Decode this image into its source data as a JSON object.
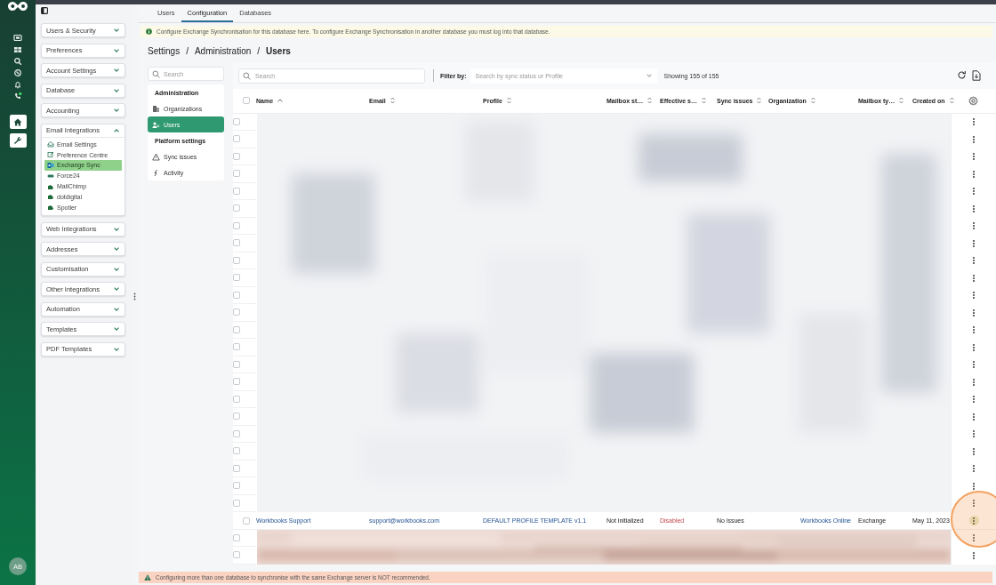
{
  "rail": {
    "avatar": "AB"
  },
  "side_menu": {
    "sections": [
      {
        "label": "Users & Security",
        "expanded": false
      },
      {
        "label": "Preferences",
        "expanded": false
      },
      {
        "label": "Account Settings",
        "expanded": false
      },
      {
        "label": "Database",
        "expanded": false
      },
      {
        "label": "Accounting",
        "expanded": false
      },
      {
        "label": "Email Integrations",
        "expanded": true,
        "items": [
          {
            "label": "Email Settings",
            "selected": false
          },
          {
            "label": "Preference Centre",
            "selected": false
          },
          {
            "label": "Exchange Sync",
            "selected": true
          },
          {
            "label": "Force24",
            "selected": false
          },
          {
            "label": "MailChimp",
            "selected": false
          },
          {
            "label": "dotdigital",
            "selected": false
          },
          {
            "label": "Spotler",
            "selected": false
          }
        ]
      },
      {
        "label": "Web Integrations",
        "expanded": false
      },
      {
        "label": "Addresses",
        "expanded": false
      },
      {
        "label": "Customisation",
        "expanded": false
      },
      {
        "label": "Other Integrations",
        "expanded": false
      },
      {
        "label": "Automation",
        "expanded": false
      },
      {
        "label": "Templates",
        "expanded": false
      },
      {
        "label": "PDF Templates",
        "expanded": false
      }
    ]
  },
  "tabs": [
    {
      "label": "Users",
      "selected": false
    },
    {
      "label": "Configuration",
      "selected": true
    },
    {
      "label": "Databases",
      "selected": false
    }
  ],
  "info_banner": "Configure Exchange Synchronisation for this database here. To configure Exchange Synchronisation in another database you must log into that database.",
  "breadcrumb": {
    "separator": "/",
    "items": [
      "Settings",
      "Administration",
      "Users"
    ]
  },
  "settings_nav": {
    "search_placeholder": "Search",
    "groups": [
      {
        "heading": "Administration",
        "items": [
          {
            "label": "Organizations",
            "selected": false
          },
          {
            "label": "Users",
            "selected": true
          }
        ]
      },
      {
        "heading": "Platform settings",
        "items": [
          {
            "label": "Sync issues",
            "selected": false
          },
          {
            "label": "Activity",
            "selected": false
          }
        ]
      }
    ]
  },
  "toolbar": {
    "search_placeholder": "Search",
    "filter_label": "Filter by:",
    "filter_placeholder": "Search by sync status or Profile",
    "count": "Showing 155 of 155"
  },
  "table": {
    "select_all": {
      "checked": false
    },
    "columns": [
      {
        "label": "Name",
        "sorted": true
      },
      {
        "label": "Email",
        "sorted": false
      },
      {
        "label": "Profile",
        "sorted": false
      },
      {
        "label": "Mailbox st…",
        "sorted": false
      },
      {
        "label": "Effective s…",
        "sorted": false
      },
      {
        "label": "Sync issues",
        "sorted": false
      },
      {
        "label": "Organization",
        "sorted": false
      },
      {
        "label": "Mailbox ty…",
        "sorted": false
      },
      {
        "label": "Created on",
        "sorted": false
      }
    ],
    "rows": [
      {
        "kind": "blurred",
        "checked": false,
        "highlighted": false
      },
      {
        "kind": "blurred",
        "checked": false,
        "highlighted": false
      },
      {
        "kind": "blurred",
        "checked": false,
        "highlighted": false
      },
      {
        "kind": "blurred",
        "checked": false,
        "highlighted": false
      },
      {
        "kind": "blurred",
        "checked": false,
        "highlighted": false
      },
      {
        "kind": "blurred",
        "checked": false,
        "highlighted": false
      },
      {
        "kind": "blurred",
        "checked": false,
        "highlighted": false
      },
      {
        "kind": "blurred",
        "checked": false,
        "highlighted": false
      },
      {
        "kind": "blurred",
        "checked": false,
        "highlighted": false
      },
      {
        "kind": "blurred",
        "checked": false,
        "highlighted": false
      },
      {
        "kind": "blurred",
        "checked": false,
        "highlighted": false
      },
      {
        "kind": "blurred",
        "checked": false,
        "highlighted": false
      },
      {
        "kind": "blurred",
        "checked": false,
        "highlighted": false
      },
      {
        "kind": "blurred",
        "checked": false,
        "highlighted": false
      },
      {
        "kind": "blurred",
        "checked": false,
        "highlighted": false
      },
      {
        "kind": "blurred",
        "checked": false,
        "highlighted": false
      },
      {
        "kind": "blurred",
        "checked": false,
        "highlighted": false
      },
      {
        "kind": "blurred",
        "checked": false,
        "highlighted": false
      },
      {
        "kind": "blurred",
        "checked": false,
        "highlighted": false
      },
      {
        "kind": "blurred",
        "checked": false,
        "highlighted": false
      },
      {
        "kind": "blurred",
        "checked": false,
        "highlighted": false
      },
      {
        "kind": "blurred",
        "checked": false,
        "highlighted": false
      },
      {
        "kind": "blurred",
        "checked": false,
        "highlighted": false
      },
      {
        "kind": "data",
        "checked": false,
        "highlighted": true,
        "cells": [
          {
            "kind": "link",
            "text": "Workbooks Support"
          },
          {
            "kind": "link",
            "text": "support@workbooks.com"
          },
          {
            "kind": "link",
            "text": "DEFAULT PROFILE TEMPLATE v1.1"
          },
          {
            "kind": "text",
            "text": "Not initialized"
          },
          {
            "kind": "alert",
            "text": "Disabled"
          },
          {
            "kind": "text",
            "text": "No issues"
          },
          {
            "kind": "link",
            "text": "Workbooks Online"
          },
          {
            "kind": "text",
            "text": "Exchange"
          },
          {
            "kind": "text",
            "text": "May 11, 2023"
          }
        ]
      },
      {
        "kind": "blurred",
        "checked": false,
        "highlighted": false
      },
      {
        "kind": "blurred",
        "checked": false,
        "highlighted": false
      }
    ]
  },
  "warning_banner": "Configuring more than one database to synchronise with the same Exchange server is NOT recommended."
}
